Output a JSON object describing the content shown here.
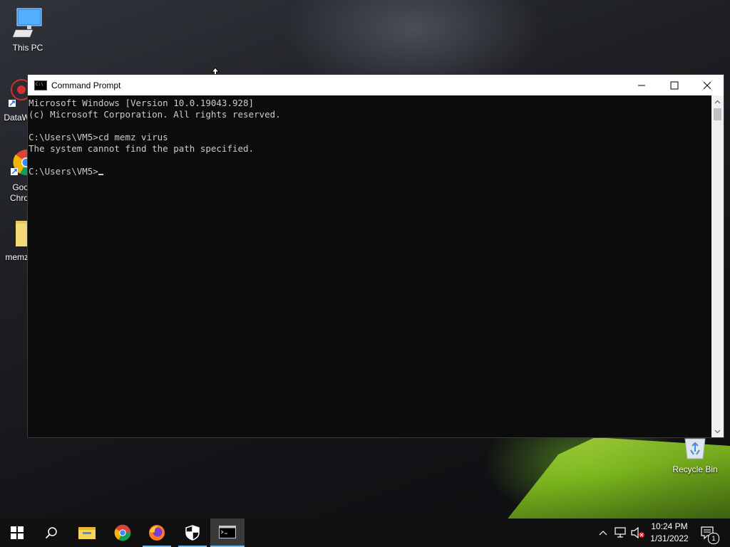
{
  "desktop": {
    "icons": [
      {
        "label": "This PC"
      },
      {
        "label": "DataW"
      },
      {
        "label": "Goo\nChro"
      },
      {
        "label": "memz"
      },
      {
        "label": "Recycle Bin"
      }
    ]
  },
  "window": {
    "title": "Command Prompt",
    "console_lines": [
      "Microsoft Windows [Version 10.0.19043.928]",
      "(c) Microsoft Corporation. All rights reserved.",
      "",
      "C:\\Users\\VM5>cd memz virus",
      "The system cannot find the path specified.",
      "",
      "C:\\Users\\VM5>"
    ]
  },
  "taskbar": {
    "clock_time": "10:24 PM",
    "clock_date": "1/31/2022",
    "notification_count": "1"
  },
  "colors": {
    "console_bg": "#0c0c0c",
    "console_text": "#cccccc",
    "taskbar_bg": "#101010",
    "accent": "#76b9ed"
  }
}
